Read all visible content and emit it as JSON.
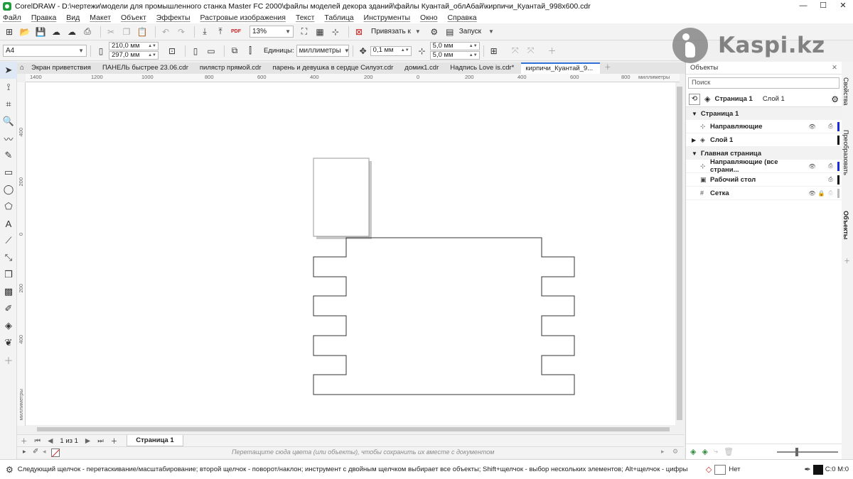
{
  "window": {
    "title": "CorelDRAW - D:\\чертежи\\модели для промышленного станка Master FC 2000\\файлы моделей декора зданий\\файлы Куантай_облАбай\\кирпичи_Куантай_998x600.cdr",
    "minimize": "—",
    "maximize": "☐",
    "close": "✕"
  },
  "menu": [
    "Файл",
    "Правка",
    "Вид",
    "Макет",
    "Объект",
    "Эффекты",
    "Растровые изображения",
    "Текст",
    "Таблица",
    "Инструменты",
    "Окно",
    "Справка"
  ],
  "toolbar": {
    "zoom": "13%",
    "snap_label": "Привязать к",
    "launch_label": "Запуск",
    "pdf": "PDF"
  },
  "propbar": {
    "page_size": "A4",
    "width": "210,0 мм",
    "height": "297,0 мм",
    "units_label": "Единицы:",
    "units_value": "миллиметры",
    "nudge": "0,1 мм",
    "dup_x": "5,0 мм",
    "dup_y": "5,0 мм"
  },
  "tabs": [
    "Экран приветствия",
    "ПАНЕЛЬ быстрее 23.06.cdr",
    "пилястр прямой.cdr",
    "парень и девушка в сердце Силуэт.cdr",
    "домик1.cdr",
    "Надпись Love is.cdr*",
    "кирпичи_Куантай_9..."
  ],
  "ruler": {
    "h_ticks": [
      "1400",
      "1200",
      "1000",
      "800",
      "600",
      "400",
      "200",
      "0",
      "200",
      "400",
      "600",
      "800",
      "1000",
      "1200"
    ],
    "v_ticks": [
      "400",
      "200",
      "0",
      "200",
      "400"
    ],
    "unit": "миллиметры",
    "h_unit": "миллиметры"
  },
  "pagenav": {
    "counter": "1 из 1",
    "page_tab": "Страница 1"
  },
  "palette_hint": "Перетащите сюда цвета (или объекты), чтобы сохранить их вместе с документом",
  "status": {
    "message": "Следующий щелчок - перетаскивание/масштабирование; второй щелчок - поворот/наклон; инструмент с двойным щелчком выбирает все объекты; Shift+щелчок - выбор нескольких элементов; Alt+щелчок - цифры",
    "fill_label": "Нет",
    "outline": "C:0 M:0"
  },
  "panel": {
    "title": "Объекты",
    "search_placeholder": "Поиск",
    "page": "Страница 1",
    "layer": "Слой 1",
    "groups": [
      {
        "name": "Страница 1",
        "items": [
          {
            "label": "Направляющие",
            "icon": "guides-icon",
            "eye": true,
            "print": true,
            "color": "#1a2bd8"
          },
          {
            "label": "Слой 1",
            "icon": "layer-icon",
            "expand": true,
            "eye": false,
            "print": false,
            "color": "#111111"
          }
        ]
      },
      {
        "name": "Главная страница",
        "items": [
          {
            "label": "Направляющие (все страни...",
            "icon": "guides-icon",
            "eye": true,
            "print": true,
            "color": "#1a2bd8"
          },
          {
            "label": "Рабочий стол",
            "icon": "desktop-icon",
            "eye": false,
            "print": true,
            "color": "#111111"
          },
          {
            "label": "Сетка",
            "icon": "grid-icon",
            "eye": true,
            "print": true,
            "color": "#bbbbbb"
          }
        ]
      }
    ]
  },
  "side_tabs": [
    "Свойства",
    "Преобразовать",
    "Объекты"
  ],
  "brand": "Kaspi.kz"
}
